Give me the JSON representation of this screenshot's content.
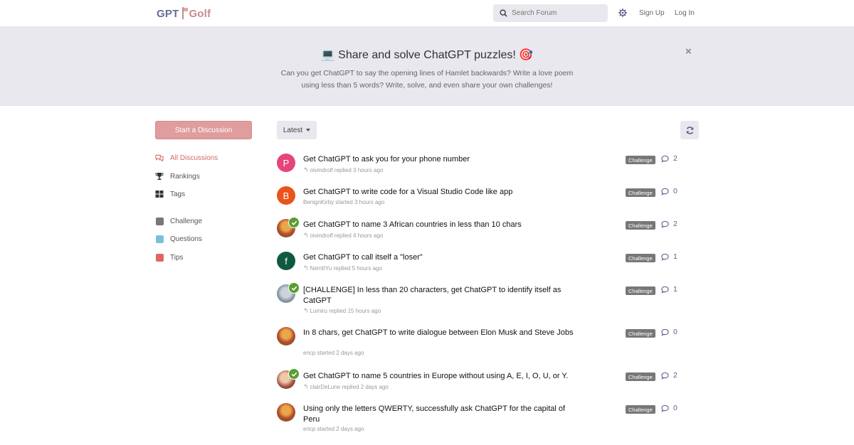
{
  "header": {
    "logo_left": "GPT",
    "logo_right": "Golf",
    "search_placeholder": "Search Forum",
    "signup": "Sign Up",
    "login": "Log In"
  },
  "hero": {
    "title": "💻 Share and solve ChatGPT puzzles! 🎯",
    "text": "Can you get ChatGPT to say the opening lines of Hamlet backwards? Write a love poem using less than 5 words? Write, solve, and even share your own challenges!",
    "close": "×"
  },
  "sidebar": {
    "start_button": "Start a Discussion",
    "nav": [
      {
        "label": "All Discussions",
        "icon": "chat-bubbles-icon"
      },
      {
        "label": "Rankings",
        "icon": "trophy-icon"
      },
      {
        "label": "Tags",
        "icon": "grid-icon"
      }
    ],
    "tags": [
      {
        "label": "Challenge",
        "color": "#777777"
      },
      {
        "label": "Questions",
        "color": "#7cbfdd"
      },
      {
        "label": "Tips",
        "color": "#e06666"
      }
    ]
  },
  "toolbar": {
    "sort": "Latest"
  },
  "discussions": [
    {
      "title": "Get ChatGPT to ask you for your phone number",
      "meta": "oivindrolf replied 3 hours ago",
      "reply": true,
      "tag": "Challenge",
      "count": "2",
      "avatar_letter": "P",
      "avatar_color": "#e5457b"
    },
    {
      "title": "Get ChatGPT to write code for a Visual Studio Code like app",
      "meta": "BenignKirby started 3 hours ago",
      "reply": false,
      "tag": "Challenge",
      "count": "0",
      "avatar_letter": "B",
      "avatar_color": "#e9541d"
    },
    {
      "title": "Get ChatGPT to name 3 African countries in less than 10 chars",
      "meta": "oivindrolf replied 4 hours ago",
      "reply": true,
      "tag": "Challenge",
      "count": "2",
      "avatar_letter": "",
      "avatar_color": "",
      "solved": true
    },
    {
      "title": "Get ChatGPT to call itself a \"loser\"",
      "meta": "NemItYu replied 5 hours ago",
      "reply": true,
      "tag": "Challenge",
      "count": "1",
      "avatar_letter": "f",
      "avatar_color": "#0f5a3e"
    },
    {
      "title": "[CHALLENGE] In less than 20 characters, get ChatGPT to identify itself as CatGPT",
      "meta": "Lumiru replied 15 hours ago",
      "reply": true,
      "tag": "Challenge",
      "count": "1",
      "avatar_letter": "",
      "avatar_color": "",
      "solved": true
    },
    {
      "title": "In 8 chars, get ChatGPT to write dialogue between Elon Musk and Steve Jobs",
      "meta": "ericp started 2 days ago",
      "reply": false,
      "tag": "Challenge",
      "count": "0",
      "avatar_letter": "",
      "avatar_color": ""
    },
    {
      "title": "Get ChatGPT to name 5 countries in Europe without using A, E, I, O, U, or Y.",
      "meta": "clairDeLune replied 2 days ago",
      "reply": true,
      "tag": "Challenge",
      "count": "2",
      "avatar_letter": "",
      "avatar_color": "",
      "solved": true
    },
    {
      "title": "Using only the letters QWERTY, successfully ask ChatGPT for the capital of Peru",
      "meta": "ericp started 2 days ago",
      "reply": false,
      "tag": "Challenge",
      "count": "0",
      "avatar_letter": "",
      "avatar_color": ""
    }
  ]
}
